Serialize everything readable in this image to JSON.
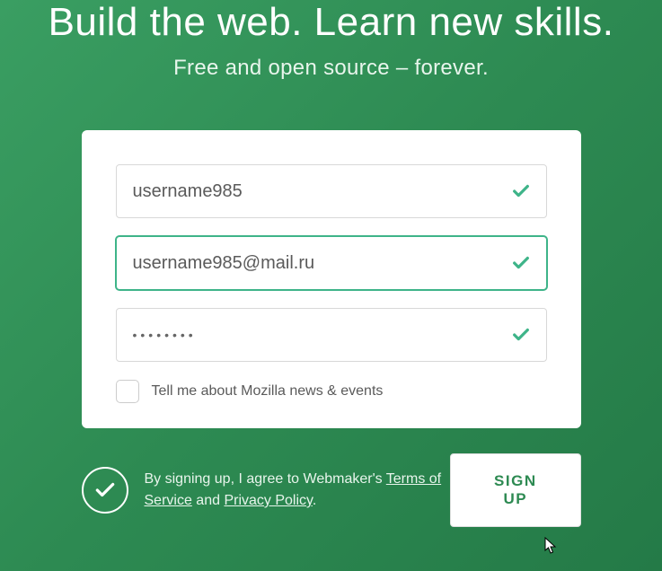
{
  "hero": {
    "title": "Build the web. Learn new skills.",
    "subtitle": "Free and open source – forever."
  },
  "form": {
    "username": {
      "value": "username985",
      "valid": true
    },
    "email": {
      "value": "username985@mail.ru",
      "valid": true,
      "focused": true
    },
    "password": {
      "value": "••••••••",
      "valid": true
    },
    "newsletter": {
      "checked": false,
      "label": "Tell me about Mozilla news & events"
    }
  },
  "footer": {
    "agree_prefix": "By signing up, I agree to Webmaker's ",
    "tos_label": "Terms of Service",
    "agree_middle": " and ",
    "privacy_label": "Privacy Policy",
    "agree_suffix": ".",
    "signup_label": "SIGN UP"
  }
}
